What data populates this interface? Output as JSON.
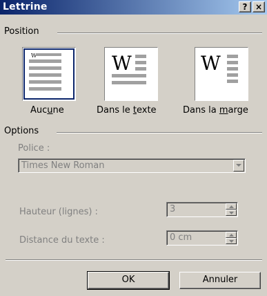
{
  "window": {
    "title": "Lettrine"
  },
  "titlebar": {
    "help_label": "?",
    "close_label": "×"
  },
  "position": {
    "group_label": "Position",
    "options": [
      {
        "label_pre": "Auc",
        "label_accel": "u",
        "label_post": "ne",
        "selected": true
      },
      {
        "label_pre": "Dans le ",
        "label_accel": "t",
        "label_post": "exte",
        "selected": false
      },
      {
        "label_pre": "Dans la ",
        "label_accel": "m",
        "label_post": "arge",
        "selected": false
      }
    ],
    "drop_letter": "W"
  },
  "options": {
    "group_label": "Options",
    "font_label": "Police :",
    "font_value": "Times New Roman",
    "height_label": "Hauteur (lignes) :",
    "height_value": "3",
    "distance_label": "Distance du texte :",
    "distance_value": "0 cm"
  },
  "buttons": {
    "ok": "OK",
    "cancel": "Annuler"
  },
  "colors": {
    "titlebar_start": "#0a246a",
    "titlebar_end": "#a6caf0",
    "face": "#d4d0c8",
    "disabled_text": "#808080"
  }
}
